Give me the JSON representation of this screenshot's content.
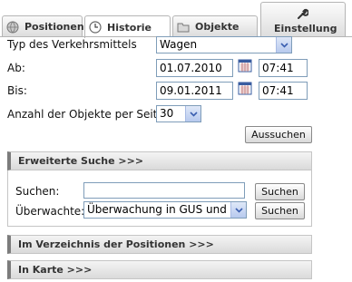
{
  "tabs": [
    {
      "label": "Positionen",
      "icon": "globe-icon"
    },
    {
      "label": "Historie",
      "icon": "clock-icon"
    },
    {
      "label": "Objekte",
      "icon": "folder-icon"
    },
    {
      "label": "Einstellung",
      "icon": "wrench-icon"
    }
  ],
  "form": {
    "transport_label": "Typ des Verkehrsmittels",
    "transport_value": "Wagen",
    "from_label": "Ab:",
    "from_date": "01.07.2010",
    "from_time": "07:41",
    "to_label": "Bis:",
    "to_date": "09.01.2011",
    "to_time": "07:41",
    "per_page_label": "Anzahl der Objekte per Seite:",
    "per_page_value": "30",
    "search_button": "Aussuchen"
  },
  "advanced": {
    "title": "Erweiterte Suche >>>",
    "search_label": "Suchen:",
    "search_value": "",
    "search_button": "Suchen",
    "monitor_label": "Überwachte:",
    "monitor_value": "Überwachung in GUS und Ba",
    "monitor_button": "Suchen"
  },
  "sections": {
    "positions_dir": "Im Verzeichnis der Positionen >>>",
    "map": "In Karte >>>"
  }
}
